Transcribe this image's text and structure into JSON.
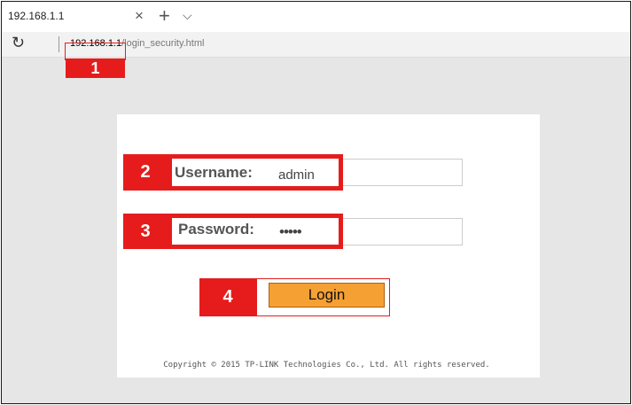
{
  "browser": {
    "tab_title": "192.168.1.1",
    "tab_close_icon": "×",
    "new_tab_icon": "+",
    "tab_dropdown_icon": "⌵",
    "reload_icon": "↻",
    "url_host": "192.168.1.1",
    "url_path": "/login_security.html"
  },
  "annotations": {
    "step1": "1",
    "step2": "2",
    "step3": "3",
    "step4": "4"
  },
  "login": {
    "username_label": "Username:",
    "username_value": "admin",
    "password_label": "Password:",
    "password_value": "•••••",
    "login_button": "Login",
    "copyright": "Copyright © 2015 TP-LINK Technologies Co., Ltd. All rights reserved."
  },
  "colors": {
    "annotation_red": "#e61c1c",
    "login_orange": "#f5a033",
    "page_background": "#e6e6e6"
  }
}
